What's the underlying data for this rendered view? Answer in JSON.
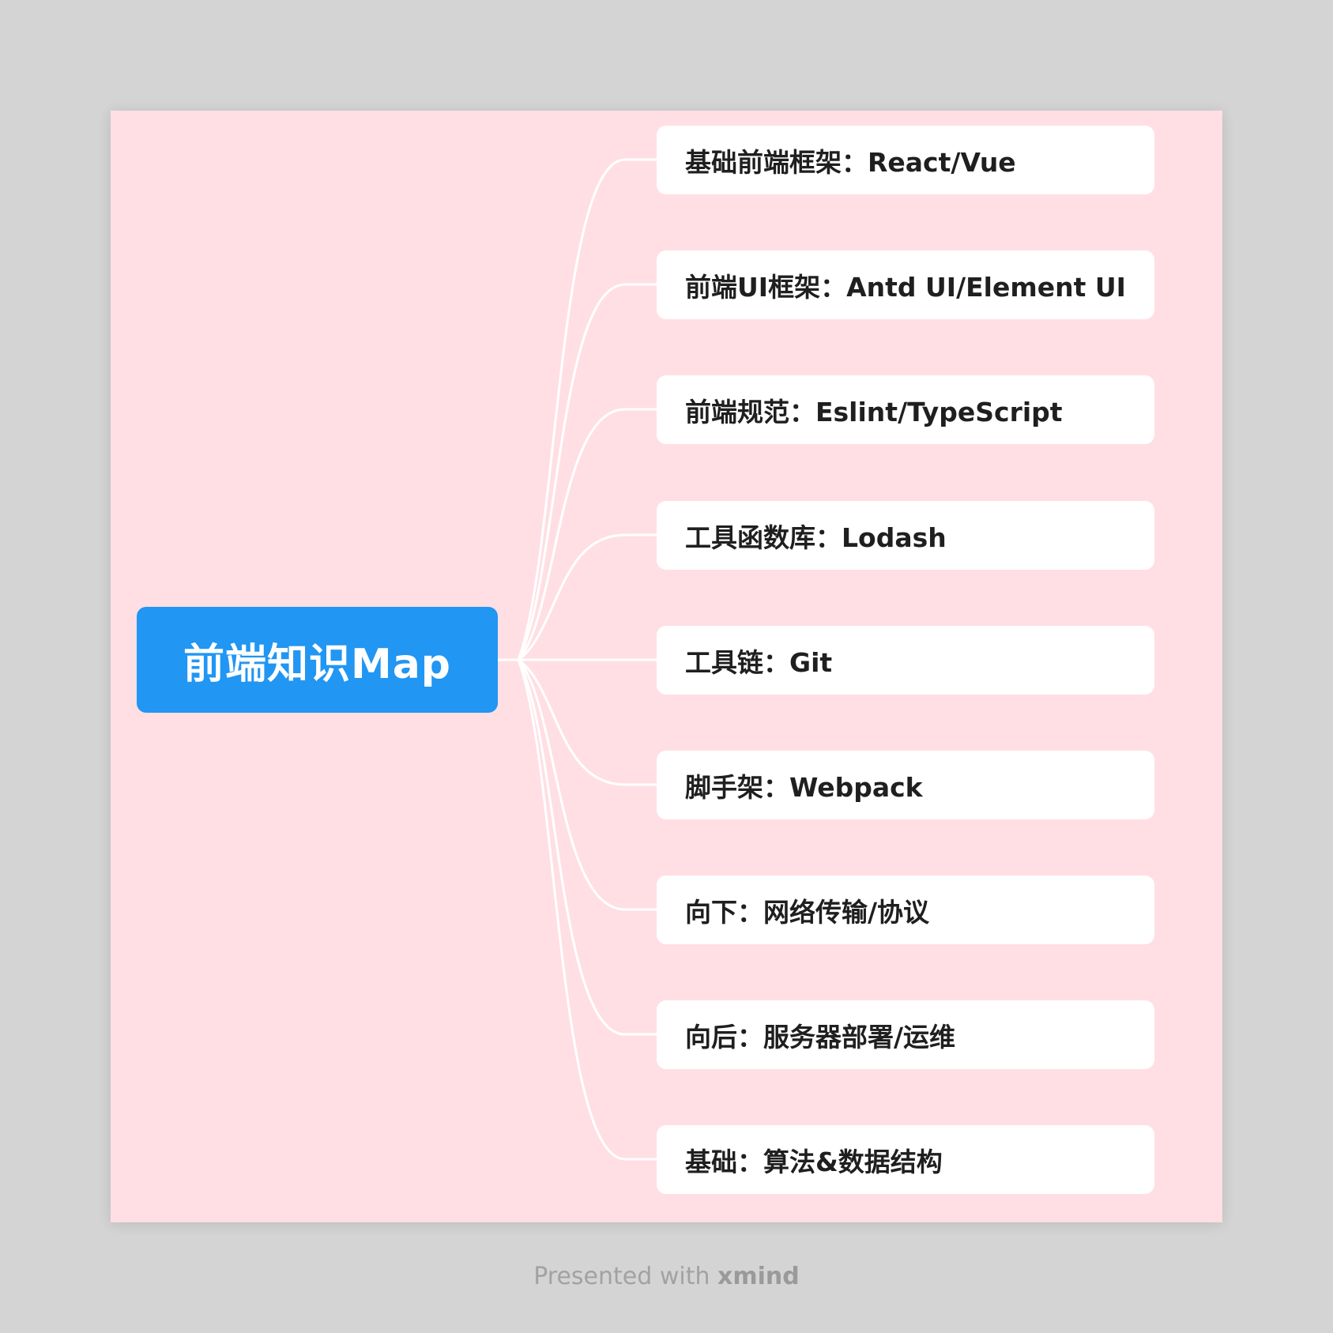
{
  "map": {
    "root": "前端知识Map",
    "branches": [
      "基础前端框架：React/Vue",
      "前端UI框架：Antd UI/Element UI",
      "前端规范：Eslint/TypeScript",
      "工具函数库：Lodash",
      "工具链：Git",
      "脚手架：Webpack",
      "向下：网络传输/协议",
      "向后：服务器部署/运维",
      "基础：算法&数据结构"
    ]
  },
  "footer": {
    "prefix": "Presented with",
    "brand": "xmind"
  },
  "colors": {
    "page_background": "#d4d4d4",
    "canvas_background": "#ffdfe4",
    "root_fill": "#2196f3",
    "branch_fill": "#ffffff",
    "connector": "#ffffff"
  }
}
